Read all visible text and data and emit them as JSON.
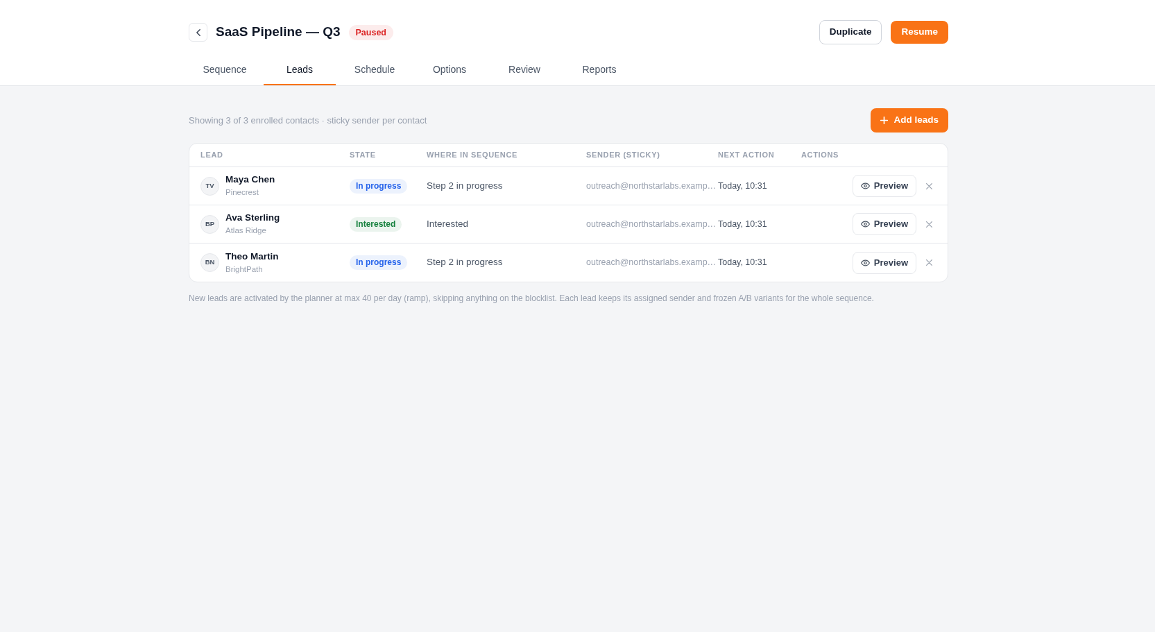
{
  "title": "SaaS Pipeline — Q3",
  "status_badge": {
    "label": "Paused",
    "color": "#dc2626"
  },
  "header_buttons": [
    {
      "label": "Duplicate",
      "kind": "secondary"
    },
    {
      "label": "Resume",
      "kind": "primary"
    }
  ],
  "tabs": [
    {
      "label": "Sequence",
      "selected": false
    },
    {
      "label": "Leads",
      "selected": true
    },
    {
      "label": "Schedule",
      "selected": false
    },
    {
      "label": "Options",
      "selected": false
    },
    {
      "label": "Review",
      "selected": false
    },
    {
      "label": "Reports",
      "selected": false
    }
  ],
  "summary": "Showing 3 of 3 enrolled contacts · sticky sender per contact",
  "add_button": {
    "label": "Add leads"
  },
  "table": {
    "columns": [
      "LEAD",
      "STATE",
      "WHERE IN SEQUENCE",
      "SENDER (STICKY)",
      "NEXT ACTION",
      "ACTIONS"
    ],
    "rows": [
      {
        "initials": "TV",
        "name": "Maya Chen",
        "company": "Pinecrest",
        "state": {
          "label": "In progress",
          "color": "#2563eb"
        },
        "where": "Step 2 in progress",
        "sender": "outreach@northstarlabs.examp…",
        "next_action": "Today, 10:31",
        "preview_button": "Preview"
      },
      {
        "initials": "BP",
        "name": "Ava Sterling",
        "company": "Atlas Ridge",
        "state": {
          "label": "Interested",
          "color": "#15803d"
        },
        "where": "Interested",
        "sender": "outreach@northstarlabs.examp…",
        "next_action": "Today, 10:31",
        "preview_button": "Preview"
      },
      {
        "initials": "BN",
        "name": "Theo Martin",
        "company": "BrightPath",
        "state": {
          "label": "In progress",
          "color": "#2563eb"
        },
        "where": "Step 2 in progress",
        "sender": "outreach@northstarlabs.examp…",
        "next_action": "Today, 10:31",
        "preview_button": "Preview"
      }
    ]
  },
  "footnote": "New leads are activated by the planner at max 40 per day (ramp), skipping anything on the blocklist. Each lead keeps its assigned sender and frozen A/B variants for the whole sequence."
}
